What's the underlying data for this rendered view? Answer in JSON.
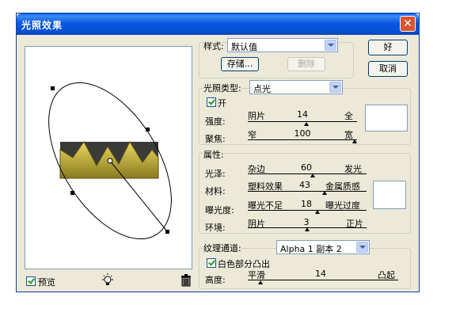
{
  "window": {
    "title": "光照效果",
    "close": "✕"
  },
  "buttons": {
    "ok": "好",
    "cancel": "取消",
    "save": "存储...",
    "delete": "删除"
  },
  "style": {
    "label": "样式:",
    "value": "默认值"
  },
  "light_type": {
    "label": "光照类型:",
    "value": "点光",
    "on_label": "开",
    "intensity": {
      "label": "强度:",
      "left": "阴片",
      "value": "14",
      "right": "全",
      "pos": 0.45
    },
    "focus": {
      "label": "聚焦:",
      "left": "窄",
      "value": "100",
      "right": "宽",
      "pos": 0.97
    }
  },
  "properties": {
    "label": "属性:",
    "gloss": {
      "label": "光泽:",
      "left": "杂边",
      "value": "60",
      "right": "发光",
      "pos": 0.55
    },
    "material": {
      "label": "材料:",
      "left": "塑料效果",
      "value": "43",
      "right": "金属质感",
      "pos": 0.72
    },
    "exposure": {
      "label": "曝光度:",
      "left": "曝光不足",
      "value": "18",
      "right": "曝光过度",
      "pos": 0.58
    },
    "ambience": {
      "label": "环境:",
      "left": "阴片",
      "value": "3",
      "right": "正片",
      "pos": 0.5
    }
  },
  "texture": {
    "label": "纹理通道:",
    "value": "Alpha 1 副本 2",
    "white_high": "白色部分凸出",
    "height": {
      "label": "高度:",
      "left": "平滑",
      "value": "14",
      "right": "凸起",
      "pos": 0.08
    }
  },
  "preview_label": "预览",
  "colors": {
    "title": "#0a57e0",
    "face": "#ece9d8",
    "close": "#d9542f"
  }
}
